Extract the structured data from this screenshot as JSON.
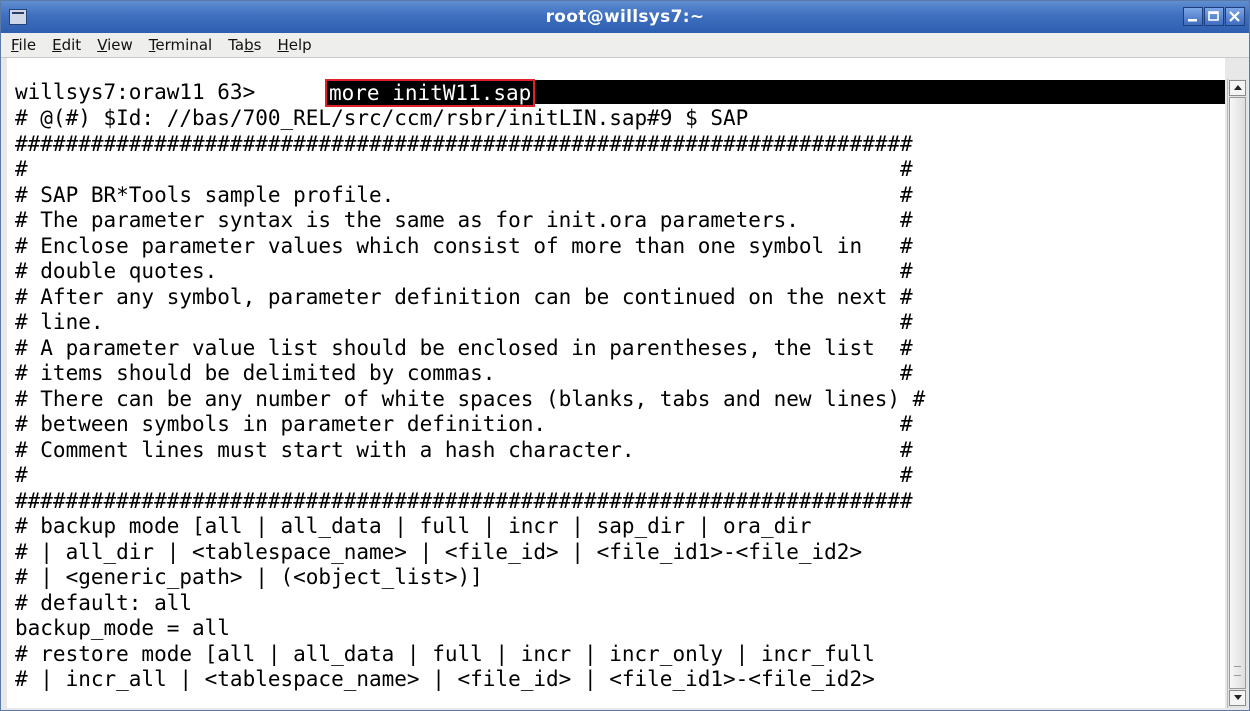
{
  "window": {
    "title": "root@willsys7:~"
  },
  "menubar": {
    "items": [
      "File",
      "Edit",
      "View",
      "Terminal",
      "Tabs",
      "Help"
    ]
  },
  "terminal": {
    "prompt": "willsys7:oraw11 63> ",
    "command": "more initW11.sap",
    "lines": [
      "# @(#) $Id: //bas/700_REL/src/ccm/rsbr/initLIN.sap#9 $ SAP",
      "#######################################################################",
      "#                                                                     #",
      "# SAP BR*Tools sample profile.                                        #",
      "# The parameter syntax is the same as for init.ora parameters.        #",
      "# Enclose parameter values which consist of more than one symbol in   #",
      "# double quotes.                                                      #",
      "# After any symbol, parameter definition can be continued on the next #",
      "# line.                                                               #",
      "# A parameter value list should be enclosed in parentheses, the list  #",
      "# items should be delimited by commas.                                #",
      "# There can be any number of white spaces (blanks, tabs and new lines) #",
      "# between symbols in parameter definition.                            #",
      "# Comment lines must start with a hash character.                     #",
      "#                                                                     #",
      "#######################################################################",
      "# backup mode [all | all_data | full | incr | sap_dir | ora_dir",
      "# | all_dir | <tablespace_name> | <file_id> | <file_id1>-<file_id2>",
      "# | <generic_path> | (<object_list>)]",
      "# default: all",
      "backup_mode = all",
      "# restore mode [all | all_data | full | incr | incr_only | incr_full",
      "# | incr_all | <tablespace_name> | <file_id> | <file_id1>-<file_id2>"
    ]
  }
}
